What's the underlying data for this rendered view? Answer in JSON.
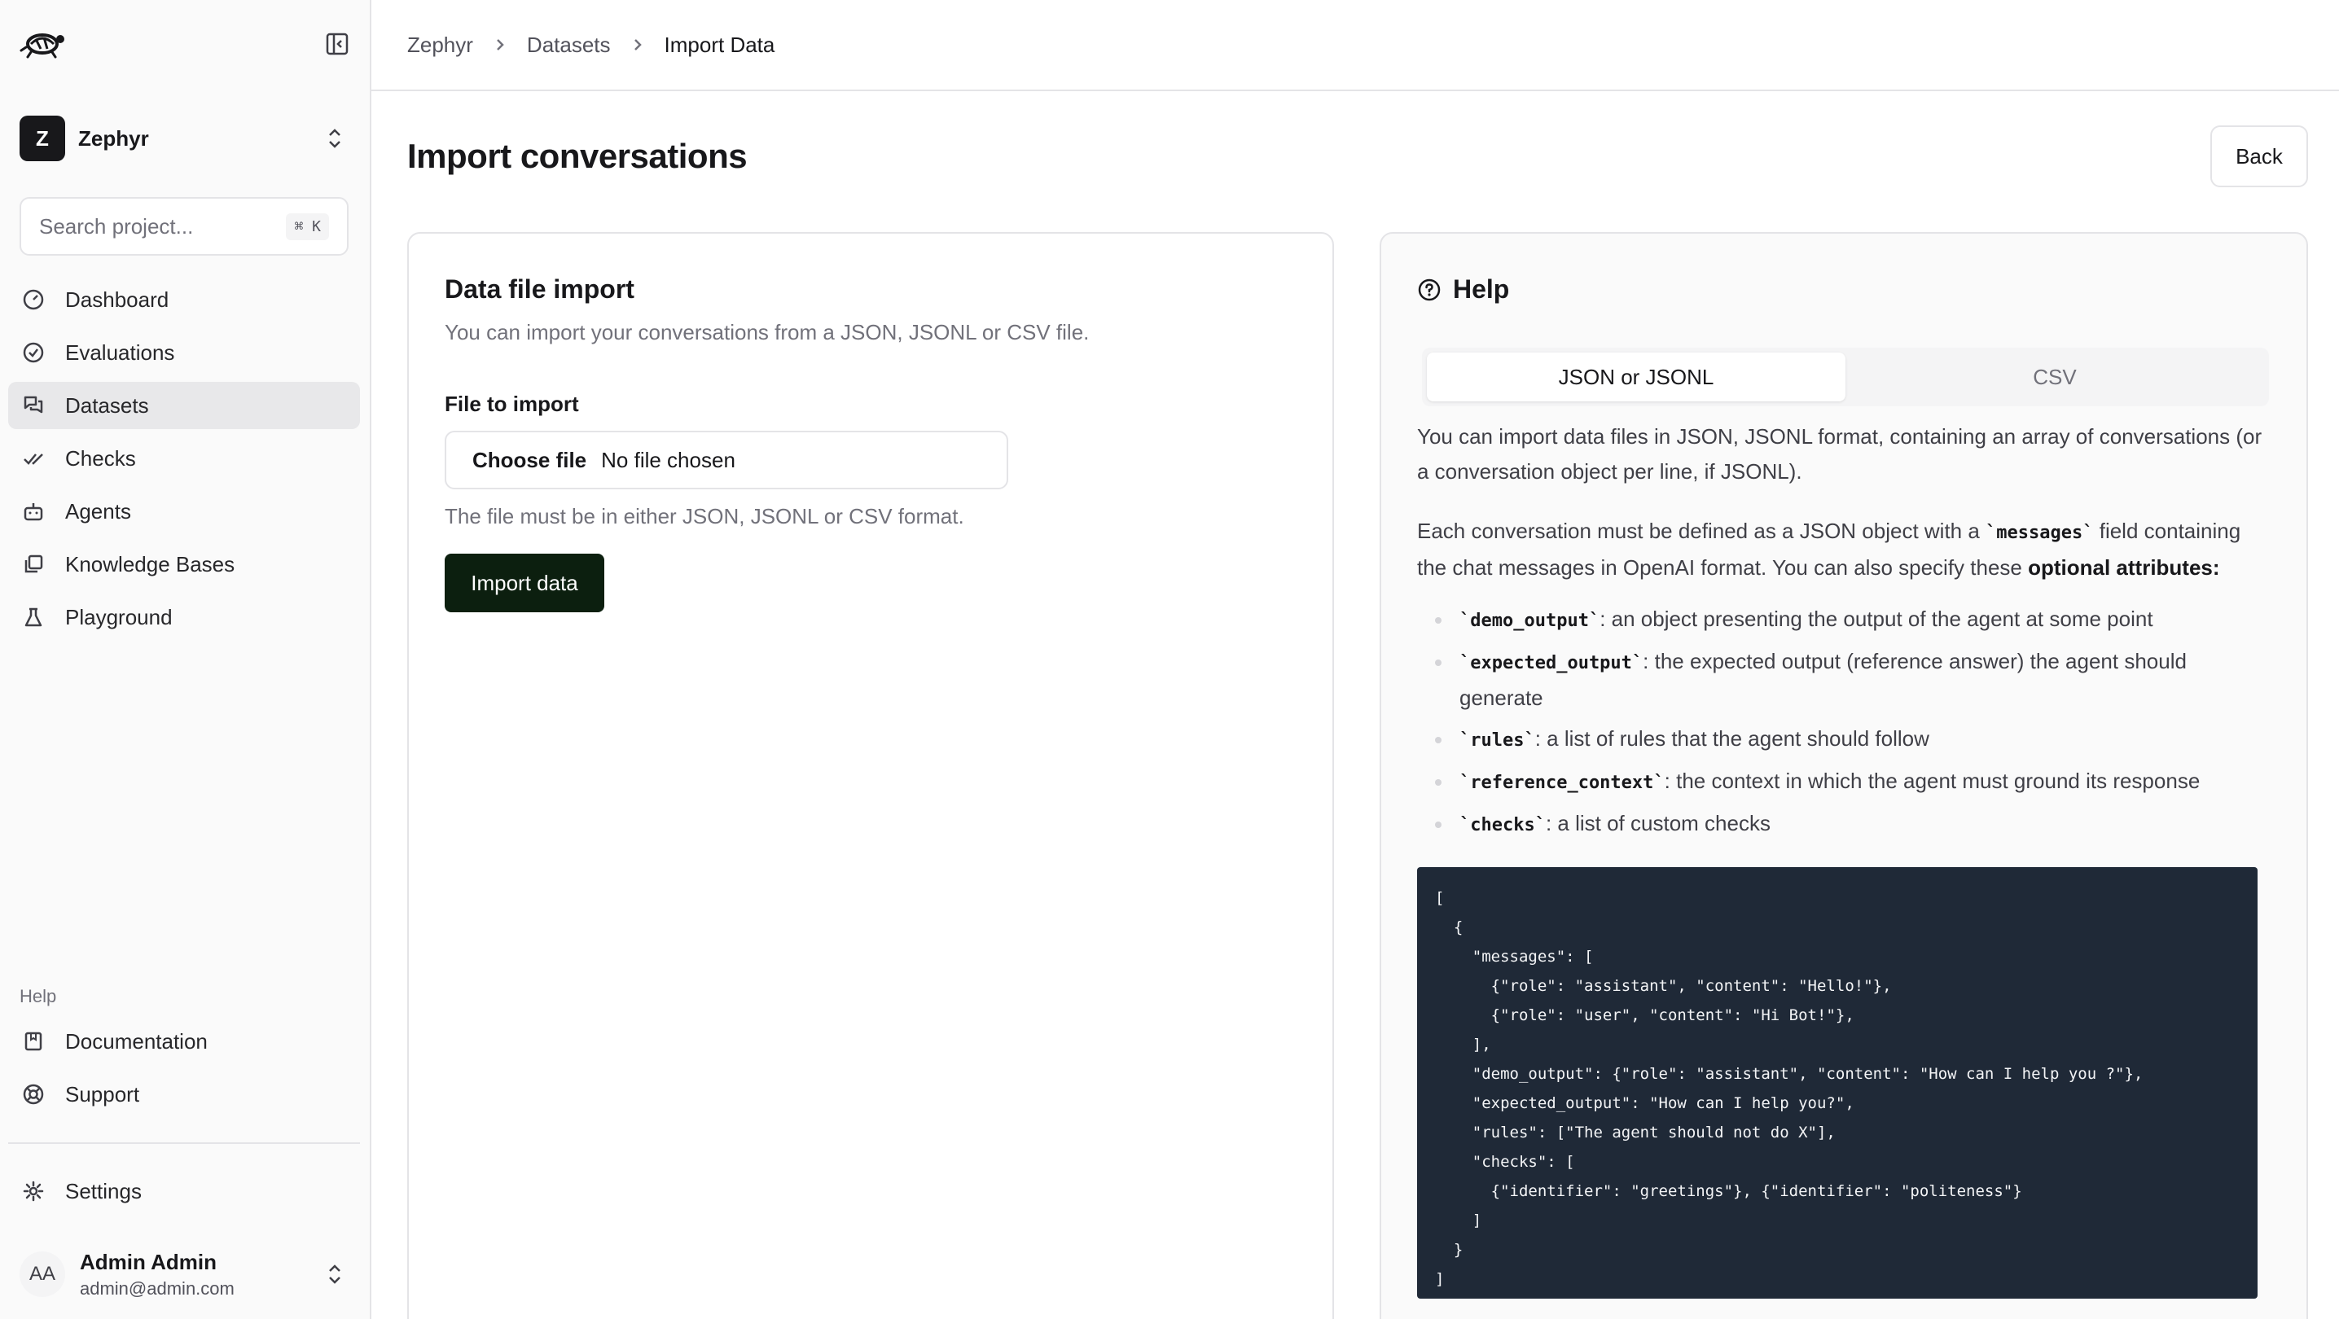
{
  "sidebar": {
    "project": {
      "initial": "Z",
      "name": "Zephyr"
    },
    "search": {
      "placeholder": "Search project...",
      "shortcut": "⌘ K"
    },
    "nav": [
      {
        "label": "Dashboard",
        "icon": "dashboard-icon"
      },
      {
        "label": "Evaluations",
        "icon": "check-circle-icon"
      },
      {
        "label": "Datasets",
        "icon": "messages-icon"
      },
      {
        "label": "Checks",
        "icon": "check-double-icon"
      },
      {
        "label": "Agents",
        "icon": "bot-icon"
      },
      {
        "label": "Knowledge Bases",
        "icon": "library-icon"
      },
      {
        "label": "Playground",
        "icon": "flask-icon"
      }
    ],
    "active_item": "Datasets",
    "help_title": "Help",
    "help_nav": [
      {
        "label": "Documentation",
        "icon": "book-icon"
      },
      {
        "label": "Support",
        "icon": "lifebuoy-icon"
      }
    ],
    "settings": {
      "label": "Settings",
      "icon": "gear-icon"
    },
    "user": {
      "initials": "AA",
      "name": "Admin Admin",
      "email": "admin@admin.com"
    }
  },
  "breadcrumb": [
    "Zephyr",
    "Datasets",
    "Import Data"
  ],
  "page": {
    "title": "Import conversations",
    "back_label": "Back"
  },
  "import_card": {
    "title": "Data file import",
    "description": "You can import your conversations from a JSON, JSONL or CSV file.",
    "field_label": "File to import",
    "choose_file_label": "Choose file",
    "no_file_label": "No file chosen",
    "hint": "The file must be in either JSON, JSONL or CSV format.",
    "import_button": "Import data"
  },
  "help_card": {
    "title": "Help",
    "tabs": [
      "JSON or JSONL",
      "CSV"
    ],
    "active_tab": "JSON or JSONL",
    "intro": "You can import data files in JSON, JSONL format, containing an array of conversations (or a conversation object per line, if JSONL).",
    "p2_before": "Each conversation must be defined as a JSON object with a ",
    "p2_code": "`messages`",
    "p2_middle": " field containing the chat messages in OpenAI format. You can also specify these ",
    "p2_strong": "optional attributes:",
    "attributes": [
      {
        "code": "`demo_output`",
        "text": ": an object presenting the output of the agent at some point"
      },
      {
        "code": "`expected_output`",
        "text": ": the expected output (reference answer) the agent should generate"
      },
      {
        "code": "`rules`",
        "text": ": a list of rules that the agent should follow"
      },
      {
        "code": "`reference_context`",
        "text": ": the context in which the agent must ground its response"
      },
      {
        "code": "`checks`",
        "text": ": a list of custom checks"
      }
    ],
    "code_example": "[\n  {\n    \"messages\": [\n      {\"role\": \"assistant\", \"content\": \"Hello!\"},\n      {\"role\": \"user\", \"content\": \"Hi Bot!\"},\n    ],\n    \"demo_output\": {\"role\": \"assistant\", \"content\": \"How can I help you ?\"},\n    \"expected_output\": \"How can I help you?\",\n    \"rules\": [\"The agent should not do X\"],\n    \"checks\": [\n      {\"identifier\": \"greetings\"}, {\"identifier\": \"politeness\"}\n    ]\n  }\n]"
  },
  "colors": {
    "primary_button": "#0c1f0f",
    "code_bg": "#1f2937",
    "sidebar_bg": "#fafafa"
  }
}
